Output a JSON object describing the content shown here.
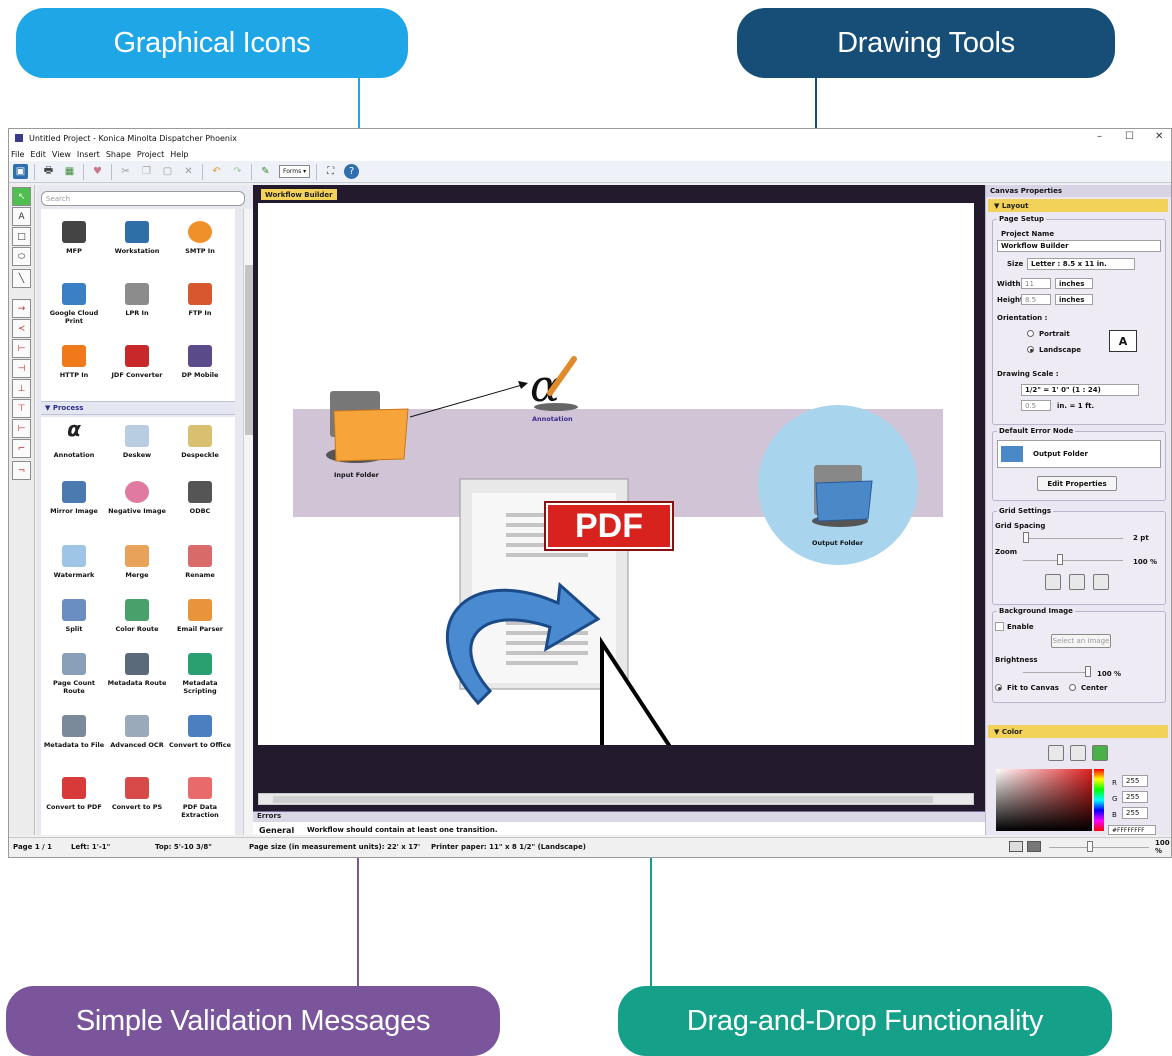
{
  "callouts": {
    "graphical_icons": "Graphical Icons",
    "drawing_tools": "Drawing Tools",
    "validation": "Simple Validation Messages",
    "dragdrop": "Drag-and-Drop Functionality"
  },
  "colors": {
    "callout_blue": "#1ea6e6",
    "callout_navy": "#164e78",
    "callout_purple": "#7a559c",
    "callout_teal": "#14a089"
  },
  "window": {
    "title": "Untitled Project - Konica Minolta Dispatcher Phoenix",
    "controls": [
      "–",
      "☐",
      "✕"
    ]
  },
  "menu": [
    "File",
    "Edit",
    "View",
    "Insert",
    "Shape",
    "Project",
    "Help"
  ],
  "toolbar": {
    "forms_label": "Forms ▾"
  },
  "palette": {
    "search_placeholder": "Search",
    "top_nodes": [
      {
        "label": "MFP"
      },
      {
        "label": "Workstation"
      },
      {
        "label": "SMTP In"
      },
      {
        "label": "Google Cloud Print"
      },
      {
        "label": "LPR In"
      },
      {
        "label": "FTP In"
      },
      {
        "label": "HTTP In"
      },
      {
        "label": "JDF Converter"
      },
      {
        "label": "DP Mobile"
      }
    ],
    "process_header": "Process",
    "process_nodes": [
      {
        "label": "Annotation"
      },
      {
        "label": "Deskew"
      },
      {
        "label": "Despeckle"
      },
      {
        "label": "Mirror Image"
      },
      {
        "label": "Negative Image"
      },
      {
        "label": "ODBC"
      },
      {
        "label": "Watermark"
      },
      {
        "label": "Merge"
      },
      {
        "label": "Rename"
      },
      {
        "label": "Split"
      },
      {
        "label": "Color Route"
      },
      {
        "label": "Email Parser"
      },
      {
        "label": "Page Count Route"
      },
      {
        "label": "Metadata Route"
      },
      {
        "label": "Metadata Scripting"
      },
      {
        "label": "Metadata to File"
      },
      {
        "label": "Advanced OCR"
      },
      {
        "label": "Convert to Office"
      },
      {
        "label": "Convert to PDF"
      },
      {
        "label": "Convert to PS"
      },
      {
        "label": "PDF Data Extraction"
      }
    ]
  },
  "canvas": {
    "tab_label": "Workflow Builder",
    "input_folder": "Input Folder",
    "annotation": "Annotation",
    "output_folder": "Output Folder",
    "pdf_badge": "PDF"
  },
  "errors": {
    "title": "Errors",
    "category": "General",
    "message": "Workflow should contain at least one transition."
  },
  "statusbar": {
    "page": "Page 1 / 1",
    "left": "Left:  1'-1\"",
    "top": "Top:  5'-10 3/8\"",
    "page_size": "Page size (in measurement units):  22' x 17'",
    "printer_paper": "Printer paper:  11\" x 8 1/2\"  (Landscape)",
    "zoom": "100 %"
  },
  "properties": {
    "title": "Canvas Properties",
    "layout_header": "Layout",
    "page_setup": "Page Setup",
    "project_name_label": "Project Name",
    "project_name_value": "Workflow Builder",
    "size_label": "Size",
    "size_value": "Letter :  8.5 x 11 in.",
    "width_label": "Width",
    "width_value": "11",
    "height_label": "Height",
    "height_value": "8.5",
    "unit": "inches",
    "orientation_label": "Orientation :",
    "portrait": "Portrait",
    "landscape": "Landscape",
    "orientation_preview": "A",
    "drawing_scale_label": "Drawing Scale :",
    "drawing_scale_value": "1/2\" = 1' 0\"  (1 : 24)",
    "scale_input": "0.5",
    "scale_suffix": "in.  =  1 ft.",
    "default_error_node": "Default Error Node",
    "error_node_value": "Output Folder",
    "edit_properties": "Edit Properties",
    "grid_settings": "Grid Settings",
    "grid_spacing_label": "Grid Spacing",
    "grid_spacing_value": "2 pt",
    "zoom_label": "Zoom",
    "zoom_value": "100 %",
    "background_image": "Background Image",
    "enable_label": "Enable",
    "select_image": "Select an Image",
    "brightness_label": "Brightness",
    "brightness_value": "100 %",
    "fit_to_canvas": "Fit to Canvas",
    "center": "Center",
    "color_header": "Color",
    "r_label": "R",
    "r_value": "255",
    "g_label": "G",
    "g_value": "255",
    "b_label": "B",
    "b_value": "255",
    "hex_value": "#FFFFFFFF"
  }
}
